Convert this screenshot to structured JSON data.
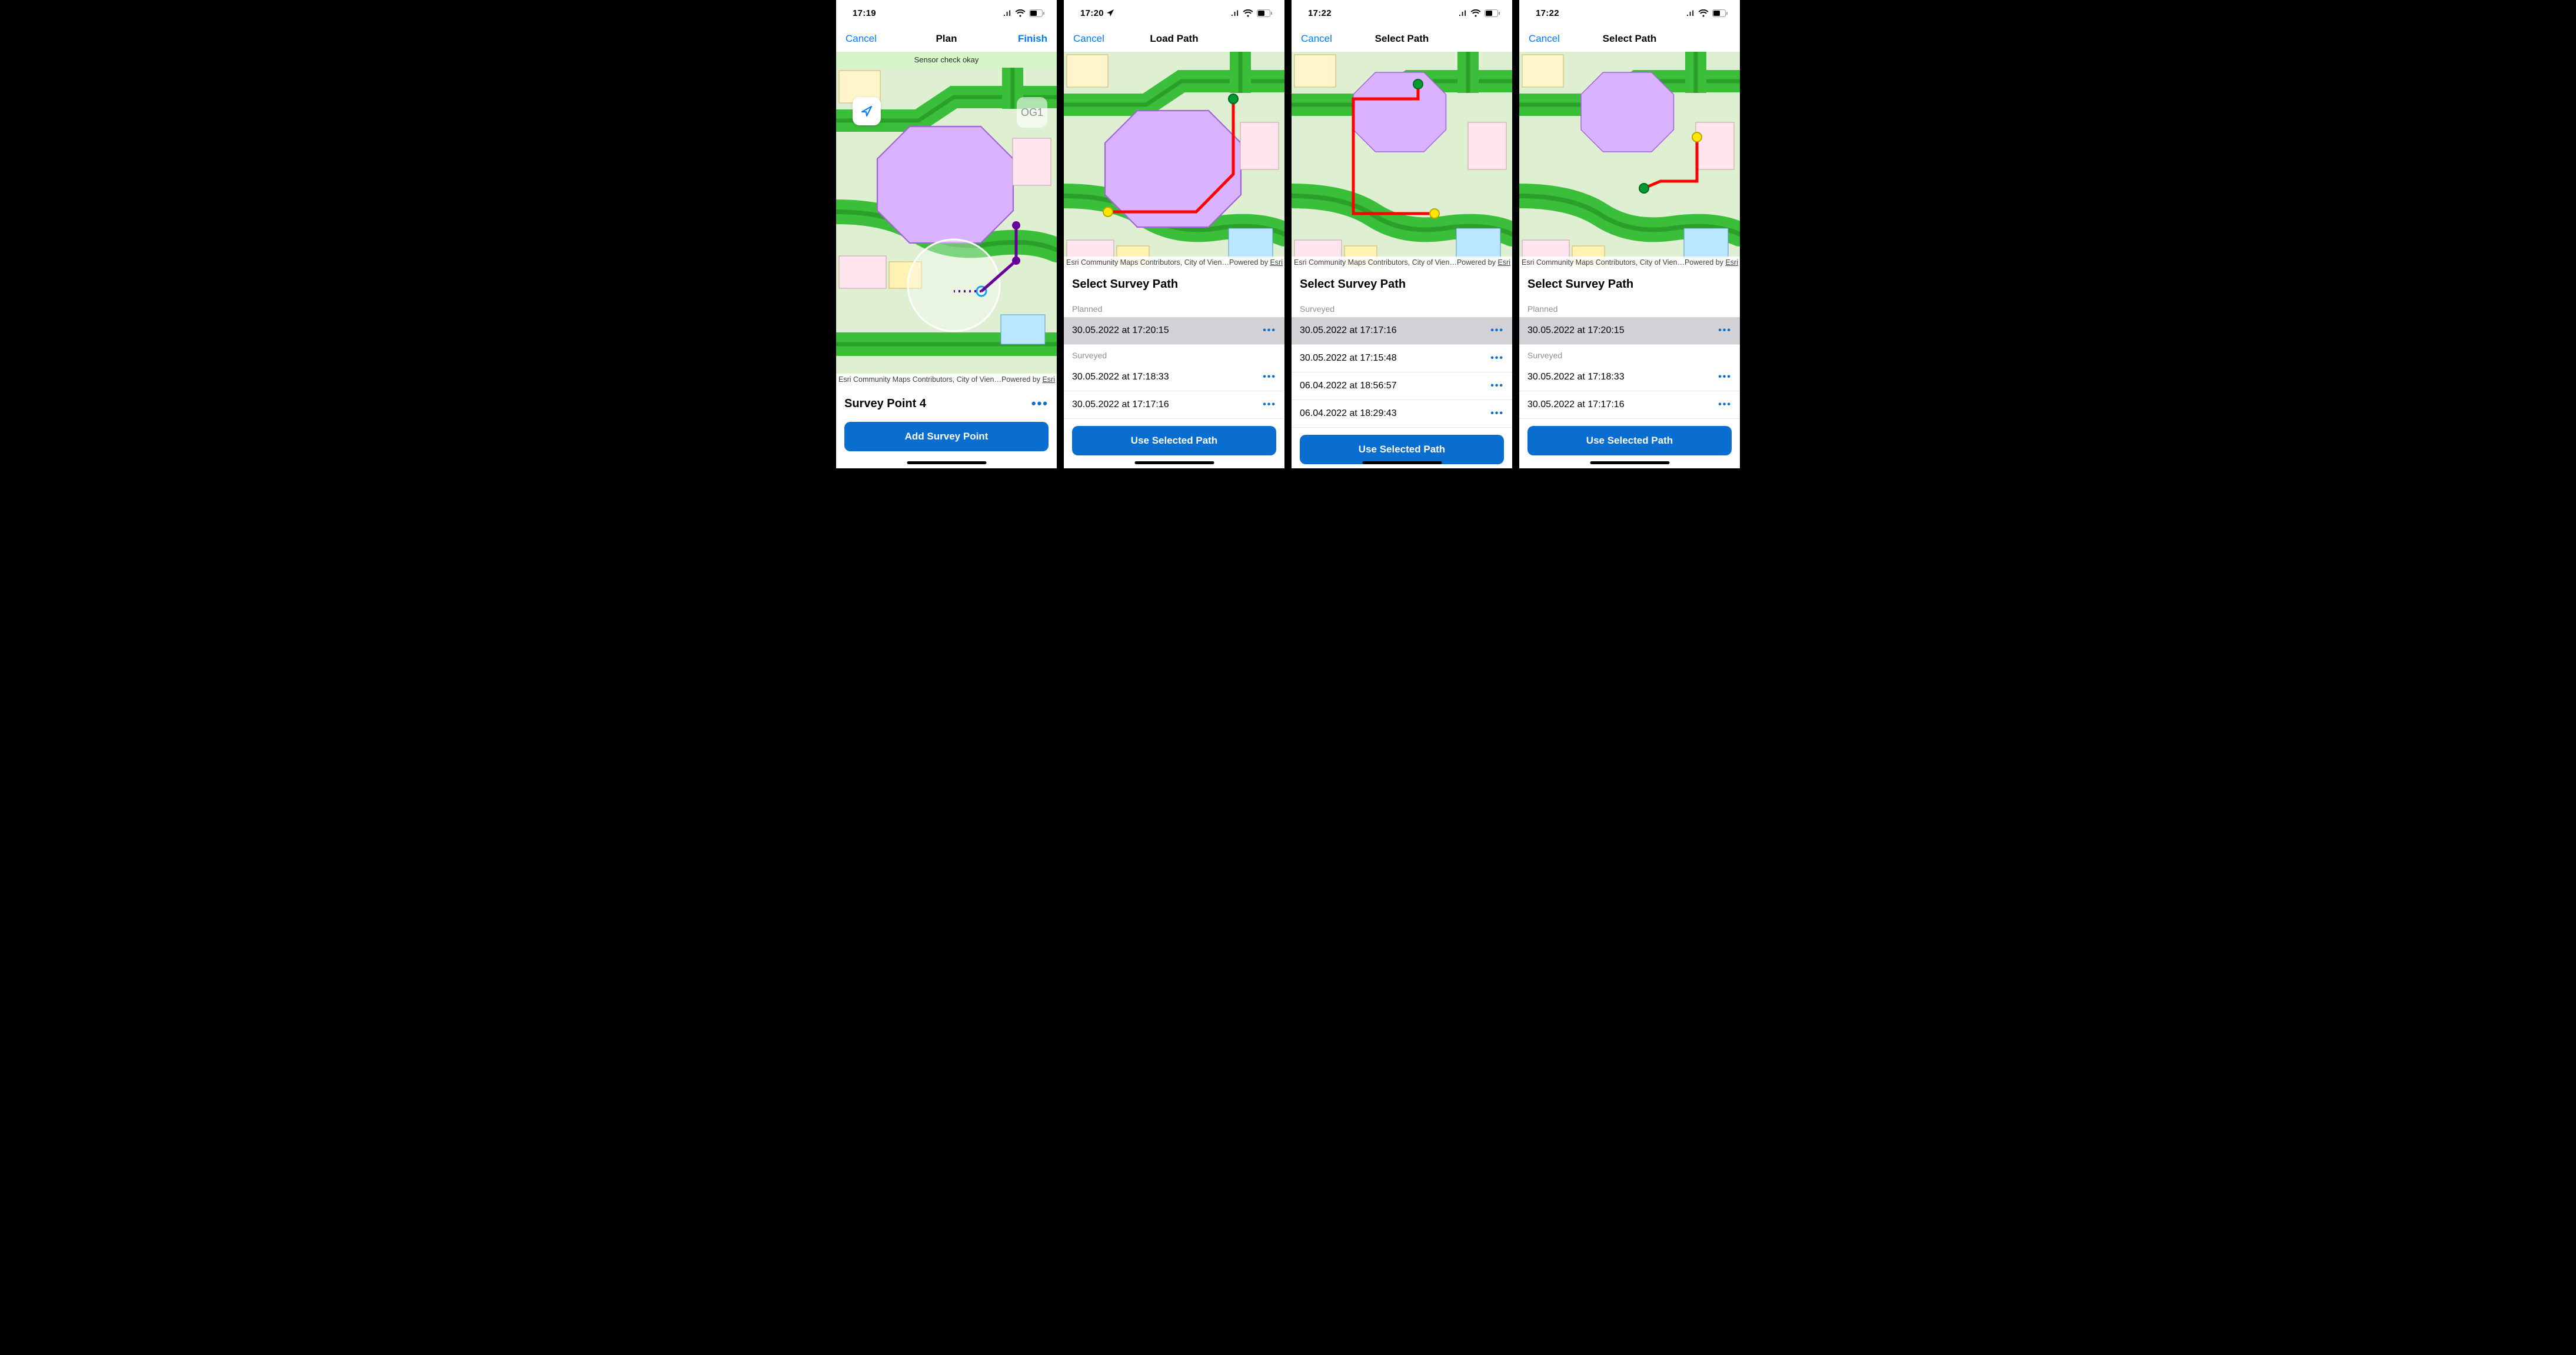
{
  "screens": [
    {
      "status_time": "17:19",
      "show_loc_icon": false,
      "nav": {
        "left": "Cancel",
        "title": "Plan",
        "right": "Finish"
      },
      "sensor_banner": "Sensor check okay",
      "floor": "OG1",
      "attrib_left": "Esri Community Maps Contributors, City of Vien…",
      "attrib_right_prefix": "Powered by ",
      "attrib_right_link": "Esri",
      "survey_point": "Survey Point 4",
      "primary": "Add Survey Point"
    },
    {
      "status_time": "17:20",
      "show_loc_icon": true,
      "nav": {
        "left": "Cancel",
        "title": "Load Path",
        "right": ""
      },
      "attrib_left": "Esri Community Maps Contributors, City of Vien…",
      "attrib_right_prefix": "Powered by ",
      "attrib_right_link": "Esri",
      "panel_title": "Select Survey Path",
      "sections": [
        {
          "header": "Planned",
          "rows": [
            "30.05.2022 at 17:20:15"
          ],
          "selected_index": 0
        },
        {
          "header": "Surveyed",
          "rows": [
            "30.05.2022 at 17:18:33",
            "30.05.2022 at 17:17:16"
          ],
          "selected_index": -1
        }
      ],
      "primary": "Use Selected Path"
    },
    {
      "status_time": "17:22",
      "show_loc_icon": false,
      "nav": {
        "left": "Cancel",
        "title": "Select Path",
        "right": ""
      },
      "attrib_left": "Esri Community Maps Contributors, City of Vien…",
      "attrib_right_prefix": "Powered by ",
      "attrib_right_link": "Esri",
      "panel_title": "Select Survey Path",
      "sections": [
        {
          "header": "Surveyed",
          "rows": [
            "30.05.2022 at 17:17:16",
            "30.05.2022 at 17:15:48",
            "06.04.2022 at 18:56:57",
            "06.04.2022 at 18:29:43"
          ],
          "selected_index": 0
        }
      ],
      "primary": "Use Selected Path"
    },
    {
      "status_time": "17:22",
      "show_loc_icon": false,
      "nav": {
        "left": "Cancel",
        "title": "Select Path",
        "right": ""
      },
      "attrib_left": "Esri Community Maps Contributors, City of Vien…",
      "attrib_right_prefix": "Powered by ",
      "attrib_right_link": "Esri",
      "panel_title": "Select Survey Path",
      "sections": [
        {
          "header": "Planned",
          "rows": [
            "30.05.2022 at 17:20:15"
          ],
          "selected_index": 0
        },
        {
          "header": "Surveyed",
          "rows": [
            "30.05.2022 at 17:18:33",
            "30.05.2022 at 17:17:16"
          ],
          "selected_index": -1
        }
      ],
      "primary": "Use Selected Path"
    }
  ],
  "colors": {
    "accent": "#0a6ed1",
    "ios_blue": "#007aff",
    "path_red": "#ff0000",
    "node_green": "#009933",
    "node_yellow": "#ffe600",
    "node_purple": "#660099",
    "corridor": "#3bbf3b",
    "corridor_dark": "#2aa02a"
  }
}
